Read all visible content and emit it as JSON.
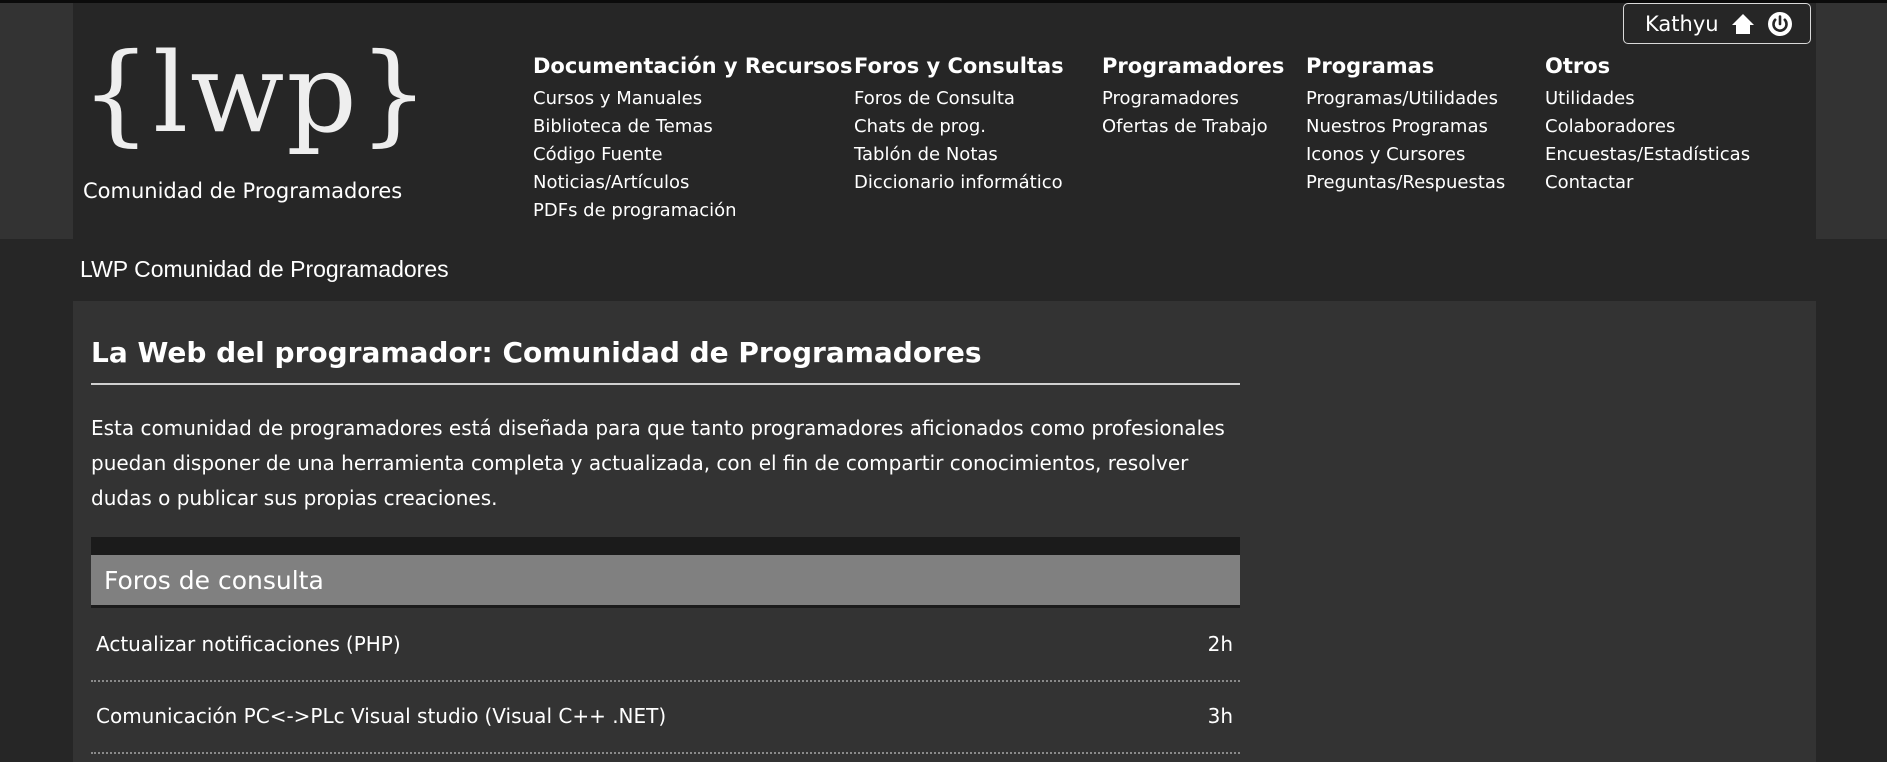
{
  "header": {
    "logo_text": "{lwp}",
    "tagline": "Comunidad de Programadores"
  },
  "nav": [
    {
      "title": "Documentación y Recursos",
      "links": [
        "Cursos y Manuales",
        "Biblioteca de Temas",
        "Código Fuente",
        "Noticias/Artículos",
        "PDFs de programación"
      ]
    },
    {
      "title": "Foros y Consultas",
      "links": [
        "Foros de Consulta",
        "Chats de prog.",
        "Tablón de Notas",
        "Diccionario informático"
      ]
    },
    {
      "title": "Programadores",
      "links": [
        "Programadores",
        "Ofertas de Trabajo"
      ]
    },
    {
      "title": "Programas",
      "links": [
        "Programas/Utilidades",
        "Nuestros Programas",
        "Iconos y Cursores",
        "Preguntas/Respuestas"
      ]
    },
    {
      "title": "Otros",
      "links": [
        "Utilidades",
        "Colaboradores",
        "Encuestas/Estadísticas",
        "Contactar"
      ]
    }
  ],
  "user": {
    "name": "Kathyu",
    "home_icon": "home-icon",
    "power_icon": "power-icon"
  },
  "breadcrumb": "LWP Comunidad de Programadores",
  "main": {
    "title": "La Web del programador: Comunidad de Programadores",
    "intro": "Esta comunidad de programadores está diseñada para que tanto programadores aficionados como profesionales puedan disponer de una herramienta completa y actualizada, con el fin de compartir conocimientos, resolver dudas o publicar sus propias creaciones."
  },
  "forums": {
    "title": "Foros de consulta",
    "items": [
      {
        "title": "Actualizar notificaciones",
        "category": "(PHP)",
        "time": "2h"
      },
      {
        "title": "Comunicación PC<->PLc Visual studio",
        "category": "(Visual C++ .NET)",
        "time": "3h"
      }
    ]
  },
  "colors": {
    "page_bg": "#262626",
    "panel_bg": "#333333",
    "forum_header_bg": "#808080",
    "text": "#ffffff"
  }
}
